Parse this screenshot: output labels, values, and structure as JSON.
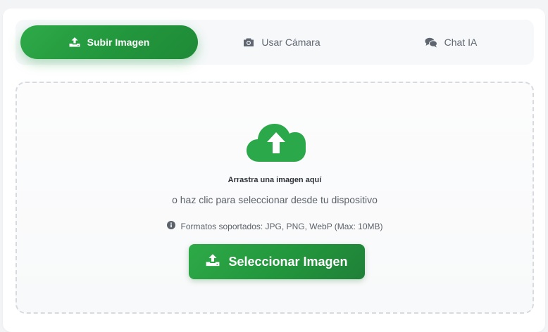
{
  "tabs": [
    {
      "label": "Subir Imagen",
      "icon": "upload-icon",
      "active": true
    },
    {
      "label": "Usar Cámara",
      "icon": "camera-icon",
      "active": false
    },
    {
      "label": "Chat IA",
      "icon": "chat-icon",
      "active": false
    }
  ],
  "dropzone": {
    "icon": "cloud-upload-icon",
    "title": "Arrastra una imagen aquí",
    "subtitle": "o haz clic para seleccionar desde tu dispositivo",
    "formats_icon": "info-icon",
    "formats": "Formatos soportados: JPG, PNG, WebP (Max: 10MB)",
    "button_label": "Seleccionar Imagen",
    "button_icon": "upload-icon"
  },
  "colors": {
    "accent": "#28a745",
    "accent_dark": "#1f8038",
    "muted_text": "#5c6269"
  }
}
